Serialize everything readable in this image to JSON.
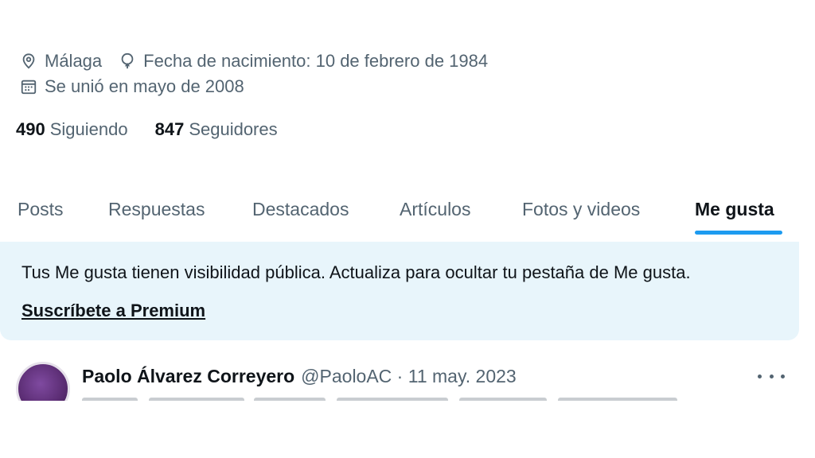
{
  "profile": {
    "location": "Málaga",
    "birthdate": "Fecha de nacimiento: 10 de febrero de 1984",
    "joined": "Se unió en mayo de 2008",
    "following_count": "490",
    "following_label": "Siguiendo",
    "followers_count": "847",
    "followers_label": "Seguidores",
    "icons": {
      "location": "location-pin-icon",
      "birthdate": "balloon-icon",
      "joined": "calendar-icon"
    }
  },
  "tabs": [
    {
      "label": "Posts",
      "active": false
    },
    {
      "label": "Respuestas",
      "active": false
    },
    {
      "label": "Destacados",
      "active": false
    },
    {
      "label": "Artículos",
      "active": false
    },
    {
      "label": "Fotos y videos",
      "active": false
    },
    {
      "label": "Me gusta",
      "active": true
    }
  ],
  "notice": {
    "message": "Tus Me gusta tienen visibilidad pública. Actualiza para ocultar tu pestaña de Me gusta.",
    "cta": "Suscríbete a Premium"
  },
  "tweet": {
    "author_name": "Paolo Álvarez Correyero",
    "handle_and_date": "@PaoloAC · 11 may. 2023",
    "more_icon": "more-horizontal-icon"
  },
  "colors": {
    "accent": "#1d9bf0",
    "notice_bg": "#e8f5fb",
    "secondary_text": "#536471",
    "primary_text": "#0f1419"
  }
}
